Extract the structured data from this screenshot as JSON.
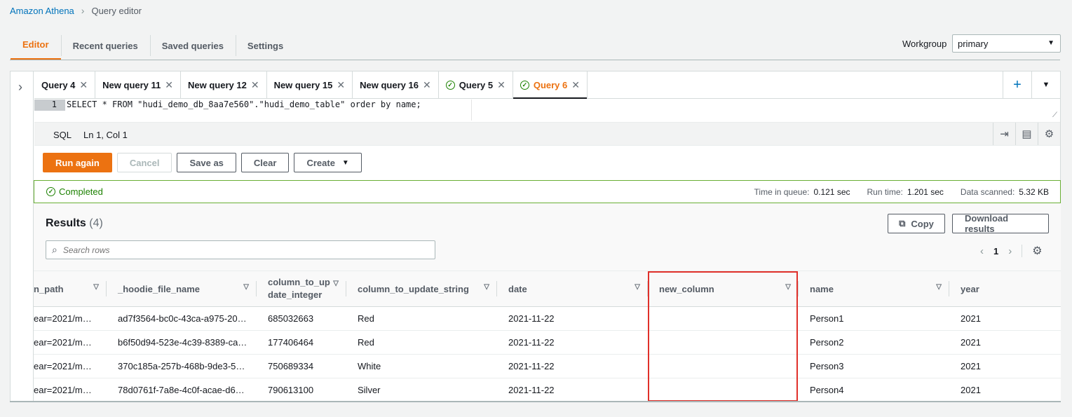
{
  "breadcrumb": {
    "root": "Amazon Athena",
    "current": "Query editor"
  },
  "main_tabs": [
    {
      "label": "Editor",
      "active": true
    },
    {
      "label": "Recent queries",
      "active": false
    },
    {
      "label": "Saved queries",
      "active": false
    },
    {
      "label": "Settings",
      "active": false
    }
  ],
  "workgroup": {
    "label": "Workgroup",
    "value": "primary"
  },
  "query_tabs": [
    {
      "label": "Query 4",
      "completed": false,
      "active": false
    },
    {
      "label": "New query 11",
      "completed": false,
      "active": false
    },
    {
      "label": "New query 12",
      "completed": false,
      "active": false
    },
    {
      "label": "New query 15",
      "completed": false,
      "active": false
    },
    {
      "label": "New query 16",
      "completed": false,
      "active": false
    },
    {
      "label": "Query 5",
      "completed": true,
      "active": false
    },
    {
      "label": "Query 6",
      "completed": true,
      "active": true
    }
  ],
  "editor": {
    "line_number": "1",
    "code": "SELECT * FROM \"hudi_demo_db_8aa7e560\".\"hudi_demo_table\" order by name;",
    "language": "SQL",
    "cursor": "Ln 1, Col 1"
  },
  "buttons": {
    "run_again": "Run again",
    "cancel": "Cancel",
    "save_as": "Save as",
    "clear": "Clear",
    "create": "Create"
  },
  "status": {
    "label": "Completed",
    "time_in_queue_label": "Time in queue:",
    "time_in_queue": "0.121 sec",
    "run_time_label": "Run time:",
    "run_time": "1.201 sec",
    "data_scanned_label": "Data scanned:",
    "data_scanned": "5.32 KB"
  },
  "results": {
    "title": "Results",
    "count": "(4)",
    "copy_label": "Copy",
    "download_label": "Download results",
    "search_placeholder": "Search rows",
    "page": "1"
  },
  "table": {
    "columns": [
      "n_path",
      "_hoodie_file_name",
      "column_to_update_integer",
      "column_to_update_string",
      "date",
      "new_column",
      "name",
      "year"
    ],
    "column_display": [
      "n_path",
      "_hoodie_file_name",
      "column_to_up date_integer",
      "column_to_update_string",
      "date",
      "new_column",
      "name",
      "year"
    ],
    "rows": [
      [
        "ear=2021/m…",
        "ad7f3564-bc0c-43ca-a975-20…",
        "685032663",
        "Red",
        "2021-11-22",
        "",
        "Person1",
        "2021"
      ],
      [
        "ear=2021/m…",
        "b6f50d94-523e-4c39-8389-ca…",
        "177406464",
        "Red",
        "2021-11-22",
        "",
        "Person2",
        "2021"
      ],
      [
        "ear=2021/m…",
        "370c185a-257b-468b-9de3-5…",
        "750689334",
        "White",
        "2021-11-22",
        "",
        "Person3",
        "2021"
      ],
      [
        "ear=2021/m…",
        "78d0761f-7a8e-4c0f-acae-d6…",
        "790613100",
        "Silver",
        "2021-11-22",
        "",
        "Person4",
        "2021"
      ]
    ]
  },
  "colors": {
    "accent": "#ec7211",
    "link": "#0073bb",
    "success": "#1d8102",
    "highlight": "#e0302a"
  }
}
